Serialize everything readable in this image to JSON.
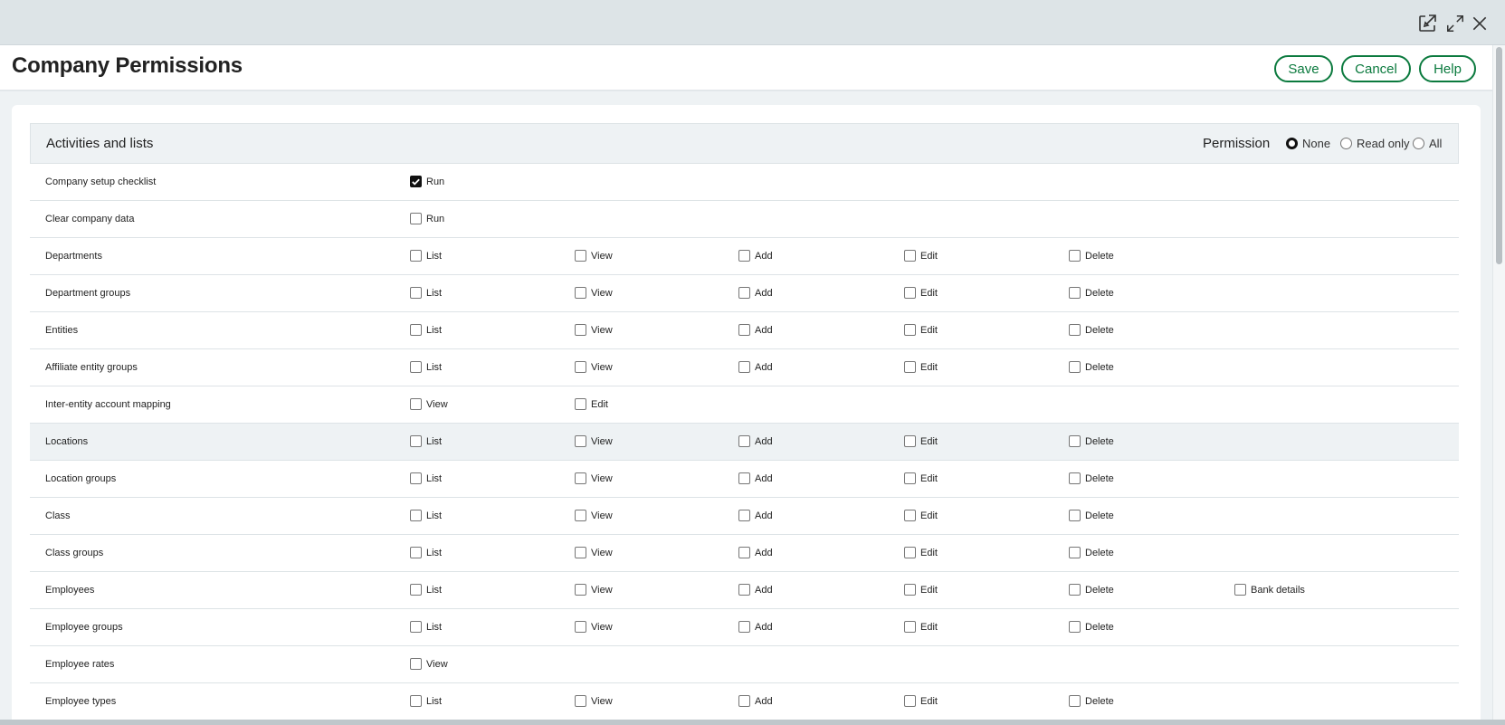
{
  "window": {
    "icons": [
      "external-link-icon",
      "expand-icon",
      "close-icon"
    ]
  },
  "header": {
    "title": "Company Permissions",
    "buttons": {
      "save": "Save",
      "cancel": "Cancel",
      "help": "Help"
    }
  },
  "section": {
    "title": "Activities and lists",
    "permission_label": "Permission",
    "radio_options": [
      {
        "label": "None",
        "selected": true
      },
      {
        "label": "Read only",
        "selected": false
      },
      {
        "label": "All",
        "selected": false
      }
    ]
  },
  "rows": [
    {
      "label": "Company setup checklist",
      "options": [
        {
          "label": "Run",
          "checked": true
        }
      ]
    },
    {
      "label": "Clear company data",
      "options": [
        {
          "label": "Run",
          "checked": false
        }
      ]
    },
    {
      "label": "Departments",
      "options": [
        {
          "label": "List",
          "checked": false
        },
        {
          "label": "View",
          "checked": false
        },
        {
          "label": "Add",
          "checked": false
        },
        {
          "label": "Edit",
          "checked": false
        },
        {
          "label": "Delete",
          "checked": false
        }
      ]
    },
    {
      "label": "Department groups",
      "options": [
        {
          "label": "List",
          "checked": false
        },
        {
          "label": "View",
          "checked": false
        },
        {
          "label": "Add",
          "checked": false
        },
        {
          "label": "Edit",
          "checked": false
        },
        {
          "label": "Delete",
          "checked": false
        }
      ]
    },
    {
      "label": "Entities",
      "options": [
        {
          "label": "List",
          "checked": false
        },
        {
          "label": "View",
          "checked": false
        },
        {
          "label": "Add",
          "checked": false
        },
        {
          "label": "Edit",
          "checked": false
        },
        {
          "label": "Delete",
          "checked": false
        }
      ]
    },
    {
      "label": "Affiliate entity groups",
      "options": [
        {
          "label": "List",
          "checked": false
        },
        {
          "label": "View",
          "checked": false
        },
        {
          "label": "Add",
          "checked": false
        },
        {
          "label": "Edit",
          "checked": false
        },
        {
          "label": "Delete",
          "checked": false
        }
      ]
    },
    {
      "label": "Inter-entity account mapping",
      "options": [
        {
          "label": "View",
          "checked": false
        },
        {
          "label": "Edit",
          "checked": false
        }
      ]
    },
    {
      "label": "Locations",
      "highlighted": true,
      "options": [
        {
          "label": "List",
          "checked": false
        },
        {
          "label": "View",
          "checked": false
        },
        {
          "label": "Add",
          "checked": false
        },
        {
          "label": "Edit",
          "checked": false
        },
        {
          "label": "Delete",
          "checked": false
        }
      ]
    },
    {
      "label": "Location groups",
      "options": [
        {
          "label": "List",
          "checked": false
        },
        {
          "label": "View",
          "checked": false
        },
        {
          "label": "Add",
          "checked": false
        },
        {
          "label": "Edit",
          "checked": false
        },
        {
          "label": "Delete",
          "checked": false
        }
      ]
    },
    {
      "label": "Class",
      "options": [
        {
          "label": "List",
          "checked": false
        },
        {
          "label": "View",
          "checked": false
        },
        {
          "label": "Add",
          "checked": false
        },
        {
          "label": "Edit",
          "checked": false
        },
        {
          "label": "Delete",
          "checked": false
        }
      ]
    },
    {
      "label": "Class groups",
      "options": [
        {
          "label": "List",
          "checked": false
        },
        {
          "label": "View",
          "checked": false
        },
        {
          "label": "Add",
          "checked": false
        },
        {
          "label": "Edit",
          "checked": false
        },
        {
          "label": "Delete",
          "checked": false
        }
      ]
    },
    {
      "label": "Employees",
      "options": [
        {
          "label": "List",
          "checked": false
        },
        {
          "label": "View",
          "checked": false
        },
        {
          "label": "Add",
          "checked": false
        },
        {
          "label": "Edit",
          "checked": false
        },
        {
          "label": "Delete",
          "checked": false
        },
        {
          "label": "Bank details",
          "checked": false
        }
      ]
    },
    {
      "label": "Employee groups",
      "options": [
        {
          "label": "List",
          "checked": false
        },
        {
          "label": "View",
          "checked": false
        },
        {
          "label": "Add",
          "checked": false
        },
        {
          "label": "Edit",
          "checked": false
        },
        {
          "label": "Delete",
          "checked": false
        }
      ]
    },
    {
      "label": "Employee rates",
      "options": [
        {
          "label": "View",
          "checked": false
        }
      ]
    },
    {
      "label": "Employee types",
      "options": [
        {
          "label": "List",
          "checked": false
        },
        {
          "label": "View",
          "checked": false
        },
        {
          "label": "Add",
          "checked": false
        },
        {
          "label": "Edit",
          "checked": false
        },
        {
          "label": "Delete",
          "checked": false
        }
      ]
    }
  ]
}
